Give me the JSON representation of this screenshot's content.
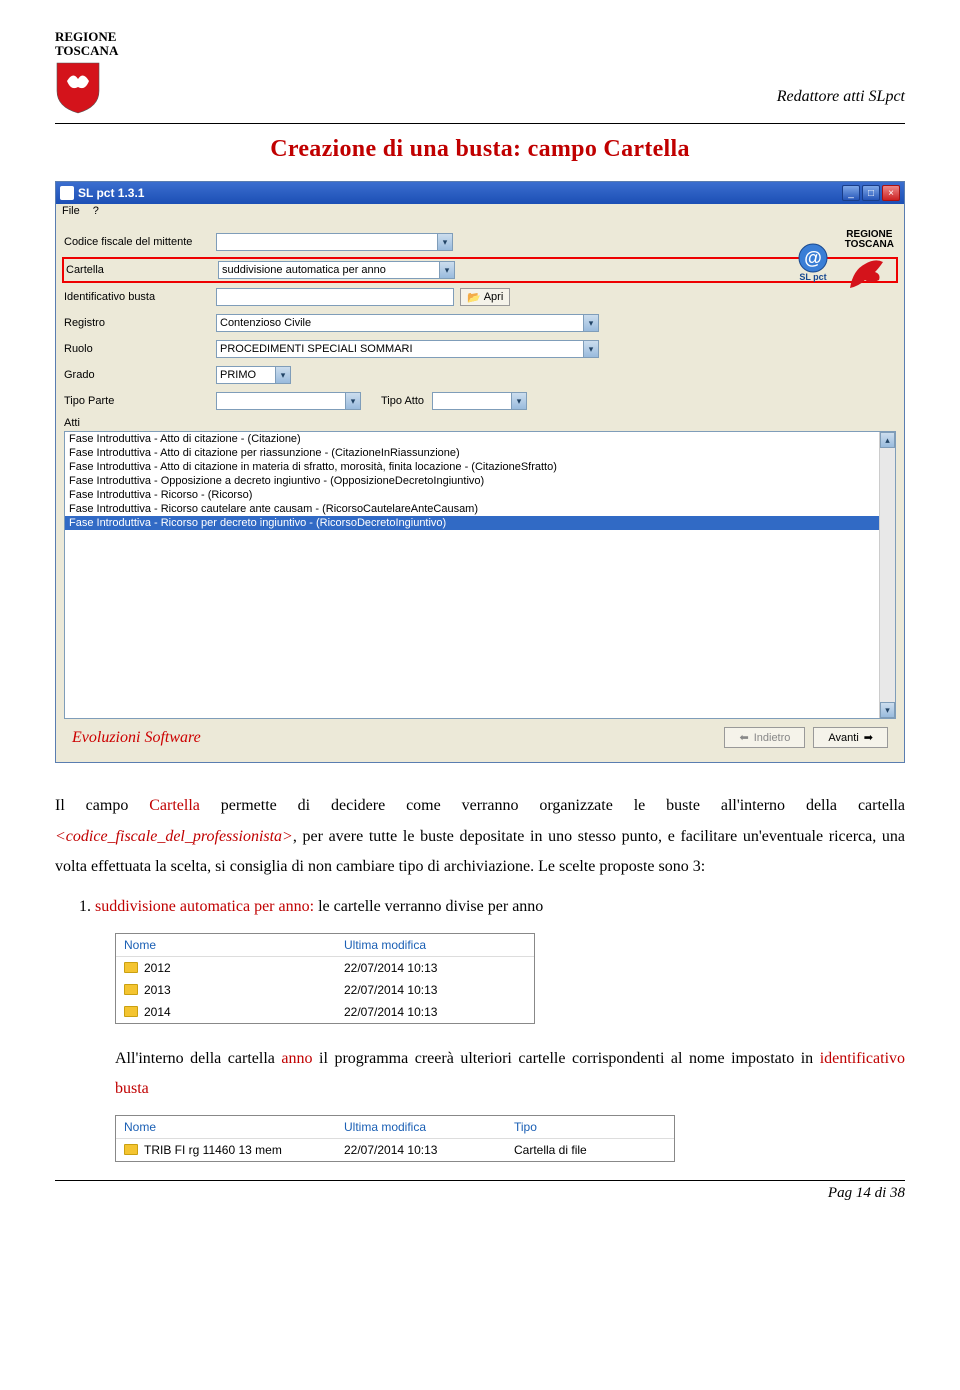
{
  "header": {
    "logo_line1": "REGIONE",
    "logo_line2": "TOSCANA",
    "right_label": "Redattore atti SLpct"
  },
  "page_title": "Creazione di una busta: campo Cartella",
  "app": {
    "window_title": "SL pct 1.3.1",
    "menu": {
      "file": "File",
      "help": "?"
    },
    "labels": {
      "codice_fiscale": "Codice fiscale del mittente",
      "cartella": "Cartella",
      "cartella_value": "suddivisione automatica per anno",
      "identificativo": "Identificativo busta",
      "apri": "Apri",
      "registro": "Registro",
      "registro_value": "Contenzioso Civile",
      "ruolo": "Ruolo",
      "ruolo_value": "PROCEDIMENTI SPECIALI SOMMARI",
      "grado": "Grado",
      "grado_value": "PRIMO",
      "tipo_parte": "Tipo Parte",
      "tipo_atto": "Tipo Atto",
      "atti": "Atti"
    },
    "right_block": {
      "slpct": "SL pct",
      "rt1": "REGIONE",
      "rt2": "TOSCANA"
    },
    "atti_items": [
      "Fase Introduttiva - Atto di citazione - (Citazione)",
      "Fase Introduttiva - Atto di citazione per riassunzione - (CitazioneInRiassunzione)",
      "Fase Introduttiva - Atto di citazione in materia di sfratto, morosità, finita locazione - (CitazioneSfratto)",
      "Fase Introduttiva - Opposizione a decreto ingiuntivo - (OpposizioneDecretoIngiuntivo)",
      "Fase Introduttiva - Ricorso - (Ricorso)",
      "Fase Introduttiva - Ricorso cautelare ante causam - (RicorsoCautelareAnteCausam)",
      "Fase Introduttiva - Ricorso per decreto ingiuntivo - (RicorsoDecretoIngiuntivo)"
    ],
    "footer": {
      "vendor": "Evoluzioni Software",
      "back": "Indietro",
      "next": "Avanti"
    }
  },
  "body": {
    "p1_a": "Il campo ",
    "p1_b": "Cartella",
    "p1_c": " permette di decidere come verranno organizzate le buste all'interno della cartella ",
    "p1_d": "<codice_fiscale_del_professionista>",
    "p1_e": ", per avere tutte le buste depositate in uno stesso punto, e facilitare un'eventuale ricerca, una volta effettuata la scelta, si consiglia di non cambiare tipo di archiviazione. Le scelte proposte sono  3:",
    "li1_a": "1. ",
    "li1_b": "suddivisione automatica per anno: ",
    "li1_c": "le cartelle verranno divise per anno"
  },
  "table1": {
    "headers": {
      "nome": "Nome",
      "mod": "Ultima modifica"
    },
    "rows": [
      {
        "nome": "2012",
        "mod": "22/07/2014 10:13"
      },
      {
        "nome": "2013",
        "mod": "22/07/2014 10:13"
      },
      {
        "nome": "2014",
        "mod": "22/07/2014 10:13"
      }
    ]
  },
  "body2": {
    "p2_a": "All'interno della cartella ",
    "p2_b": "anno",
    "p2_c": " il programma creerà ulteriori cartelle corrispondenti al nome impostato in ",
    "p2_d": "identificativo busta"
  },
  "table2": {
    "headers": {
      "nome": "Nome",
      "mod": "Ultima modifica",
      "tipo": "Tipo"
    },
    "rows": [
      {
        "nome": "TRIB FI rg 11460 13 mem",
        "mod": "22/07/2014 10:13",
        "tipo": "Cartella di file"
      }
    ]
  },
  "page_footer": "Pag 14 di 38"
}
